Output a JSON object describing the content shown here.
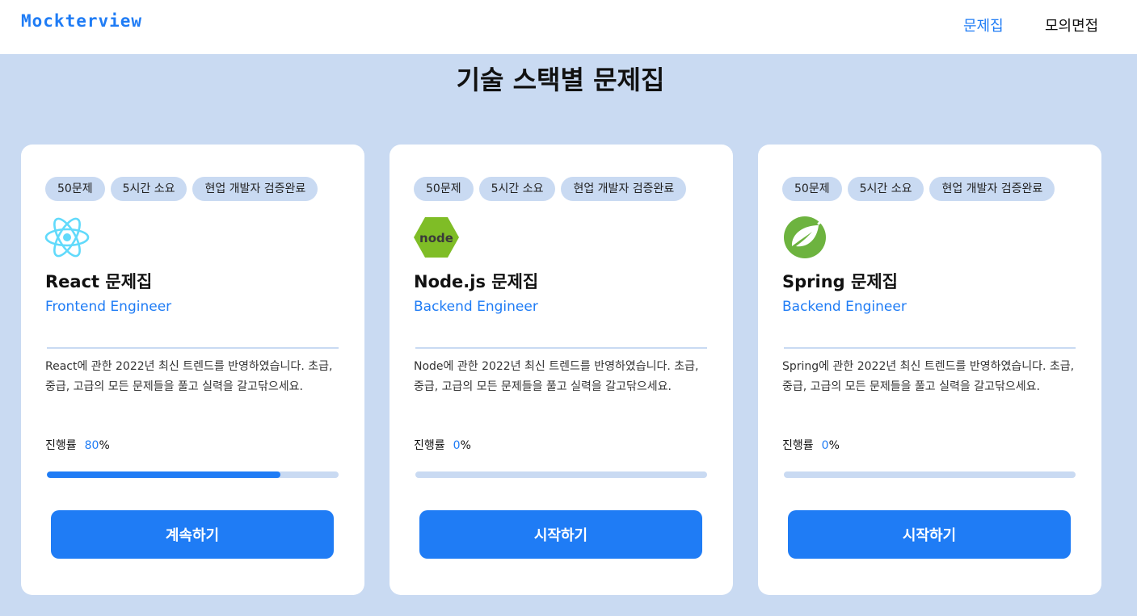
{
  "nav": {
    "logo_text": "Mockterview",
    "links": [
      {
        "label": "문제집",
        "active": true
      },
      {
        "label": "모의면접",
        "active": false
      }
    ]
  },
  "page_title": "기술 스택별 문제집",
  "colors": {
    "accent": "#1f7cf5",
    "background": "#c9daf2",
    "card": "#ffffff",
    "react": "#61dafb",
    "node": "#7fbd26",
    "spring": "#6db33f"
  },
  "cards": [
    {
      "tags": [
        "50문제",
        "5시간 소요",
        "현업 개발자 검증완료"
      ],
      "icon": "react-icon",
      "title": "React 문제집",
      "role": "Frontend Engineer",
      "description": "React에 관한 2022년 최신 트렌드를 반영하였습니다. 초급, 중급, 고급의 모든 문제들을 풀고 실력을 갈고닦으세요.",
      "progress_label": "진행률",
      "progress_value": "80",
      "progress_unit": "%",
      "progress_percent": 80,
      "button_label": "계속하기"
    },
    {
      "tags": [
        "50문제",
        "5시간 소요",
        "현업 개발자 검증완료"
      ],
      "icon": "nodejs-icon",
      "icon_text": "node",
      "title": "Node.js 문제집",
      "role": "Backend Engineer",
      "description": "Node에 관한 2022년 최신 트렌드를 반영하였습니다. 초급, 중급, 고급의 모든 문제들을 풀고 실력을 갈고닦으세요.",
      "progress_label": "진행률",
      "progress_value": "0",
      "progress_unit": "%",
      "progress_percent": 0,
      "button_label": "시작하기"
    },
    {
      "tags": [
        "50문제",
        "5시간 소요",
        "현업 개발자 검증완료"
      ],
      "icon": "spring-icon",
      "title": "Spring 문제집",
      "role": "Backend Engineer",
      "description": "Spring에 관한 2022년 최신 트렌드를 반영하였습니다. 초급, 중급, 고급의 모든 문제들을 풀고 실력을 갈고닦으세요.",
      "progress_label": "진행률",
      "progress_value": "0",
      "progress_unit": "%",
      "progress_percent": 0,
      "button_label": "시작하기"
    }
  ]
}
